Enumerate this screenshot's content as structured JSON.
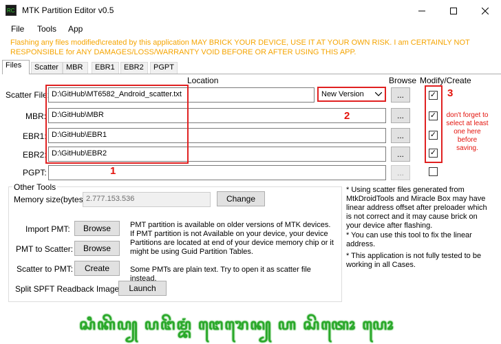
{
  "window": {
    "title": "MTK Partition Editor v0.5",
    "icon_label": "RC",
    "controls": [
      "minimize",
      "maximize",
      "close"
    ]
  },
  "menu": [
    "File",
    "Tools",
    "App"
  ],
  "warning": "Flashing any files modified\\created by this application MAY BRICK YOUR DEVICE, USE IT AT YOUR OWN RISK. I am CERTAINLY NOT RESPONSIBLE for ANY DAMAGES/LOSS/WARRANTY VOID BEFORE OR AFTER USING THIS APP.",
  "tabs": [
    "Files",
    "Scatter",
    "MBR",
    "EBR1",
    "EBR2",
    "PGPT"
  ],
  "active_tab": "Files",
  "columns": {
    "location": "Location",
    "browse": "Browse",
    "modify": "Modify/Create"
  },
  "rows": [
    {
      "label": "Scatter File:",
      "value": "D:\\GitHub\\MT6582_Android_scatter.txt",
      "browse": "...",
      "checked": true
    },
    {
      "label": "MBR:",
      "value": "D:\\GitHub\\MBR",
      "browse": "...",
      "checked": true
    },
    {
      "label": "EBR1:",
      "value": "D:\\GitHub\\EBR1",
      "browse": "...",
      "checked": true
    },
    {
      "label": "EBR2:",
      "value": "D:\\GitHub\\EBR2",
      "browse": "...",
      "checked": true
    },
    {
      "label": "PGPT:",
      "value": "",
      "browse": "...",
      "checked": false
    }
  ],
  "version_select": "New Version",
  "annotations": {
    "one": "1",
    "two": "2",
    "three": "3",
    "hint": "don't forget to select at least one here before saving."
  },
  "other_tools": {
    "legend": "Other Tools",
    "memory_label": "Memory size(bytes):",
    "memory_value": "2.777.153.536",
    "change_btn": "Change",
    "import_label": "Import PMT:",
    "import_btn": "Browse",
    "pmt_scatter_label": "PMT to Scatter:",
    "pmt_scatter_btn": "Browse",
    "scatter_pmt_label": "Scatter to PMT:",
    "scatter_pmt_btn": "Create",
    "split_label": "Split SPFT Readback Image:",
    "split_btn": "Launch",
    "pmt_note": "PMT partition is available on older versions of MTK devices. If PMT partition is not Available on your device, your device Partitions are located at end of your device memory chip or it might be using Guid Partition Tables.",
    "plain_note": "Some PMTs are plain text. Try to open it as scatter file instead."
  },
  "side_notes": [
    "* Using scatter files generated from MtkDroidTools and Miracle Box may have linear address offset after preloader which is not correct and it may cause brick on your device after flashing.",
    "* You can use this tool to fix the linear address.",
    "* This application is not fully tested to be working in all Cases."
  ],
  "footer_script": "ꦱꦶꦏꦼꦥ꧀ ꦥꦔꦼꦩ꧀ꦧꦁ ꦔꦺꦫꦺꦤ꧀ ꦲ ꦱꦼꦠꦺꦴ ꦥꦺꦴ"
}
